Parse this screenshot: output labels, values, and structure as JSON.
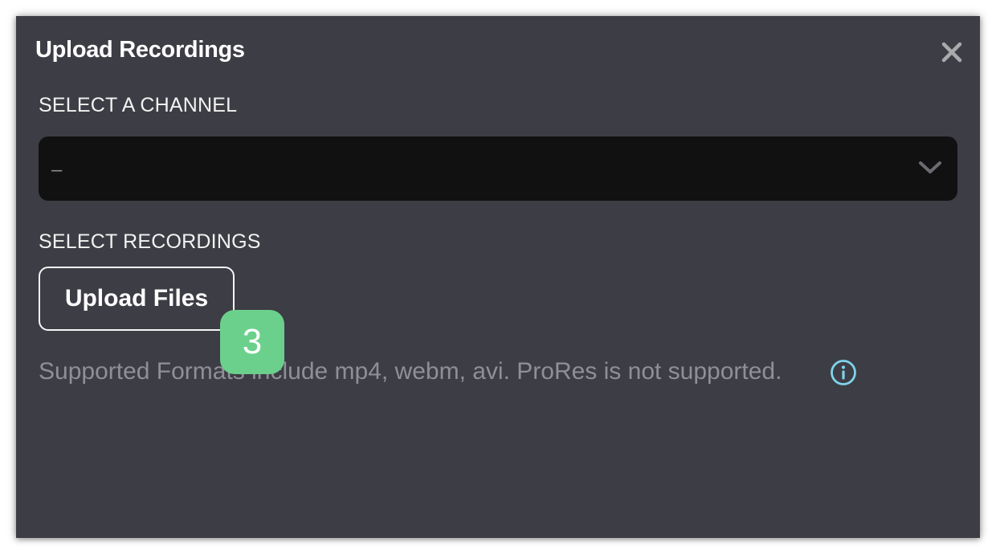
{
  "dialog": {
    "title": "Upload Recordings",
    "close_icon": "close-icon"
  },
  "channel": {
    "label": "SELECT A CHANNEL",
    "selected_value": "–",
    "dropdown_icon": "chevron-down-icon"
  },
  "recordings": {
    "label": "SELECT RECORDINGS",
    "upload_button_label": "Upload Files"
  },
  "help": {
    "text": "Supported Formats include mp4, webm, avi. ProRes is not supported.",
    "info_icon": "info-icon"
  },
  "step_badge": {
    "number": "3"
  },
  "colors": {
    "dialog_background": "#3d3d45",
    "select_background": "#111112",
    "info_accent": "#7fd3ea",
    "badge": "#6bd08c"
  }
}
